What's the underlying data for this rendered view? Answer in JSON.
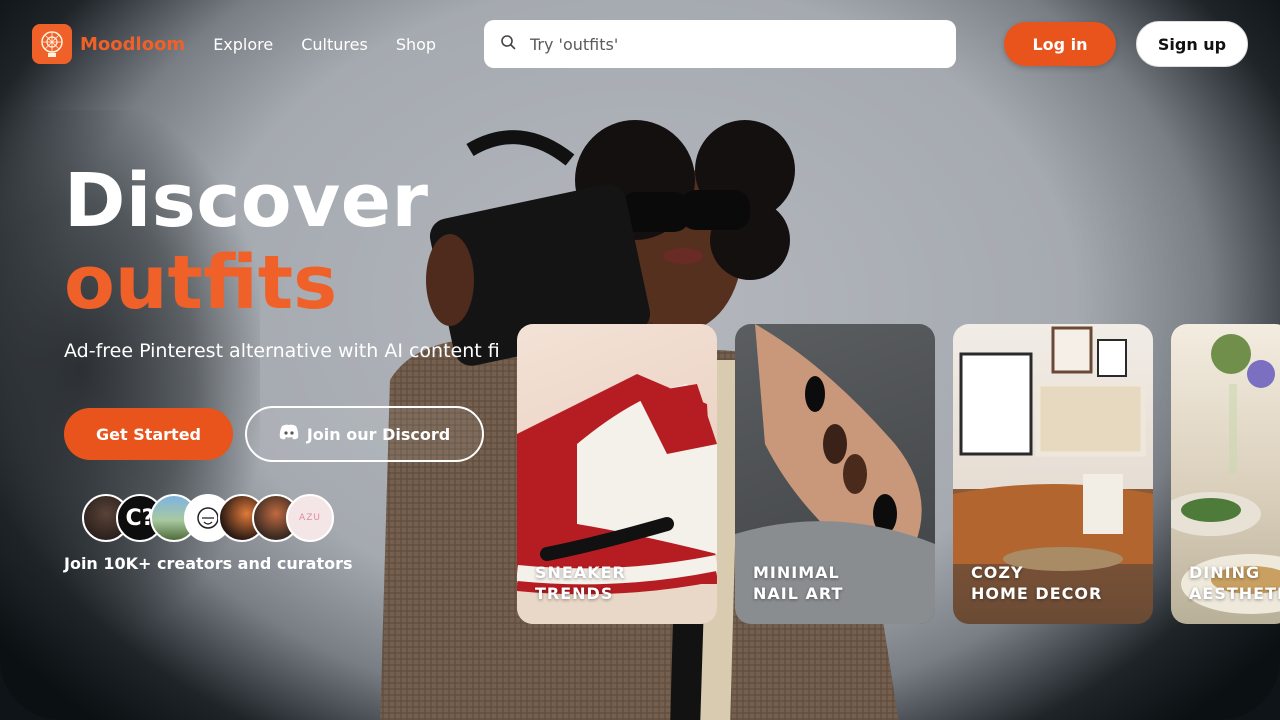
{
  "brand": {
    "name": "Moodloom",
    "accent": "#f0612a"
  },
  "nav": {
    "links": [
      "Explore",
      "Cultures",
      "Shop"
    ]
  },
  "search": {
    "placeholder": "Try 'outfits'",
    "icon": "search-icon"
  },
  "auth": {
    "login_label": "Log in",
    "signup_label": "Sign up"
  },
  "hero": {
    "title_line1": "Discover",
    "title_line2": "outfits",
    "subtitle": "Ad-free Pinterest alternative with AI content fi",
    "cta_primary": "Get Started",
    "cta_discord": "Join our Discord",
    "community_text": "Join 10K+ creators and curators"
  },
  "avatars": [
    {
      "icon": "avatar-photo"
    },
    {
      "icon": "avatar-text",
      "text": "C?"
    },
    {
      "icon": "avatar-photo"
    },
    {
      "icon": "avatar-sketch"
    },
    {
      "icon": "avatar-photo"
    },
    {
      "icon": "avatar-photo"
    },
    {
      "icon": "avatar-text",
      "text": "AZU"
    }
  ],
  "cards": [
    {
      "line1": "SNEAKER",
      "line2": "TRENDS"
    },
    {
      "line1": "MINIMAL",
      "line2": "NAIL ART"
    },
    {
      "line1": "COZY",
      "line2": "HOME DECOR"
    },
    {
      "line1": "DINING",
      "line2": "AESTHETICS"
    }
  ]
}
